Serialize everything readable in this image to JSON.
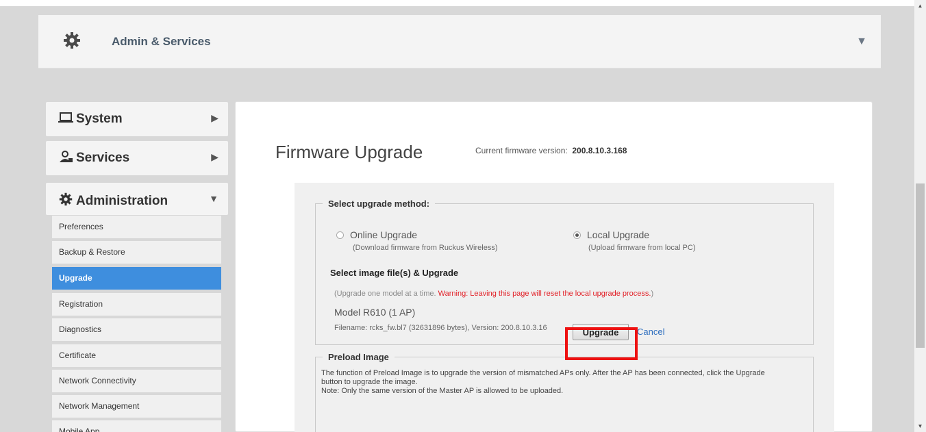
{
  "header": {
    "title": "Admin & Services",
    "icon": "gear-icon"
  },
  "nav": {
    "system": {
      "label": "System",
      "icon": "laptop-icon"
    },
    "services": {
      "label": "Services",
      "icon": "services-icon"
    },
    "administration": {
      "label": "Administration",
      "icon": "gear-icon"
    },
    "items": [
      {
        "label": "Preferences",
        "active": false
      },
      {
        "label": "Backup & Restore",
        "active": false
      },
      {
        "label": "Upgrade",
        "active": true
      },
      {
        "label": "Registration",
        "active": false
      },
      {
        "label": "Diagnostics",
        "active": false
      },
      {
        "label": "Certificate",
        "active": false
      },
      {
        "label": "Network Connectivity",
        "active": false
      },
      {
        "label": "Network Management",
        "active": false
      },
      {
        "label": "Mobile App",
        "active": false
      }
    ]
  },
  "main": {
    "title": "Firmware Upgrade",
    "fw_label": "Current firmware version:",
    "fw_version": "200.8.10.3.168",
    "method_legend": "Select upgrade method:",
    "online": {
      "label": "Online Upgrade",
      "sub": "(Download firmware from Ruckus Wireless)",
      "selected": false
    },
    "local": {
      "label": "Local Upgrade",
      "sub": "(Upload firmware from local PC)",
      "selected": true
    },
    "select_title": "Select image file(s) & Upgrade",
    "note_prefix": "(Upgrade one model at a time. ",
    "note_warning": "Warning: Leaving this page will reset the local upgrade process.",
    "note_suffix": ")",
    "model": "Model R610 (1 AP)",
    "filename": "Filename: rcks_fw.bl7 (32631896 bytes), Version: 200.8.10.3.16",
    "upgrade_label": "Upgrade",
    "cancel_label": "Cancel",
    "preload_legend": "Preload Image",
    "preload_line1": "The function of Preload Image is to upgrade the version of mismatched APs only. After the AP has been connected, click the Upgrade",
    "preload_line2": "button to upgrade the image.",
    "preload_line3": "Note: Only the same version of the Master AP is allowed to be uploaded."
  },
  "colors": {
    "active_nav": "#3e8ede",
    "warning": "#e21f26",
    "highlight_box": "#ee1111",
    "link": "#2f6fbf"
  }
}
